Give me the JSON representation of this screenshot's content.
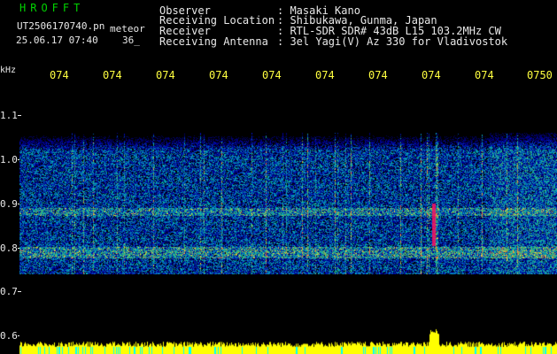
{
  "header": {
    "app_title": "HROFFT",
    "file_name": "UT2506170740.pn",
    "file_tag": "meteor",
    "date_time": "25.06.17 07:40",
    "count": "36_",
    "meta": [
      {
        "key": "Observer",
        "value": ": Masaki Kano"
      },
      {
        "key": "Receiving Location",
        "value": ": Shibukawa, Gunma, Japan"
      },
      {
        "key": "Receiver",
        "value": ": RTL-SDR SDR# 43dB L15 103.2MHz CW"
      },
      {
        "key": "Receiving Antenna",
        "value": ": 3el Yagi(V) Az 330 for Vladivostok"
      }
    ]
  },
  "axes": {
    "unit": "kHz",
    "freq_ticks": [
      "1.1",
      "1.0",
      "0.9",
      "0.8",
      "0.7",
      "0.6"
    ],
    "time_ticks": [
      "074",
      "074",
      "074",
      "074",
      "074",
      "074",
      "074",
      "074",
      "074",
      "0750"
    ]
  },
  "colors": {
    "background": "#000000",
    "text": "#e8e8e8",
    "title": "#00d200",
    "time_labels": "#ffff40",
    "meter": "#ffff00",
    "meter_base": "#00ffff",
    "echo": "#ff1060"
  }
}
